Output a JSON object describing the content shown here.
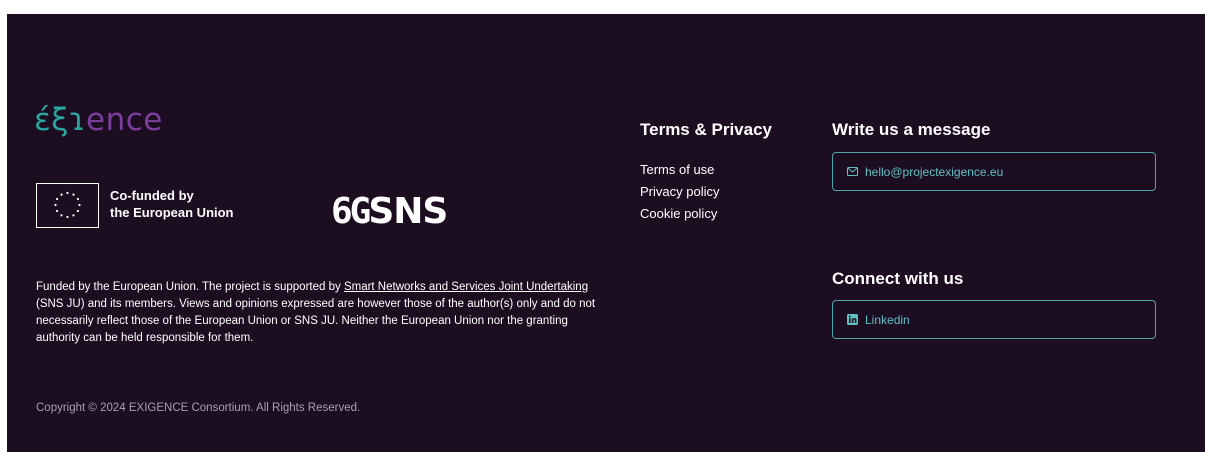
{
  "brand": {
    "logo_part1": "έξ",
    "logo_part2": "ɿ",
    "logo_part3": "ence"
  },
  "eu": {
    "line1": "Co-funded by",
    "line2": "the European Union"
  },
  "sns_logo": {
    "six": "6G",
    "sns": "SNS"
  },
  "funding": {
    "prefix": "Funded by the European Union. The project is supported by ",
    "link": "Smart Networks and Services Joint Undertaking",
    "suffix": " (SNS JU) and its members. Views and opinions expressed are however those of the author(s) only and do not necessarily reflect those of the European Union or SNS JU. Neither the European Union nor the granting authority can be held responsible for them."
  },
  "copyright": "Copyright © 2024 EXIGENCE Consortium. All Rights Reserved.",
  "terms": {
    "title": "Terms & Privacy",
    "links": [
      "Terms of use",
      "Privacy policy",
      "Cookie policy"
    ]
  },
  "contact": {
    "title": "Write us a message",
    "email": "hello@projectexigence.eu"
  },
  "connect": {
    "title": "Connect with us",
    "linkedin": "Linkedin"
  },
  "colors": {
    "background": "#1c0d21",
    "accent": "#5fc1c4",
    "logo_teal": "#2aa6a0",
    "logo_purple": "#7a3f9d"
  },
  "icons": {
    "email": "envelope-icon",
    "linkedin": "linkedin-icon"
  }
}
